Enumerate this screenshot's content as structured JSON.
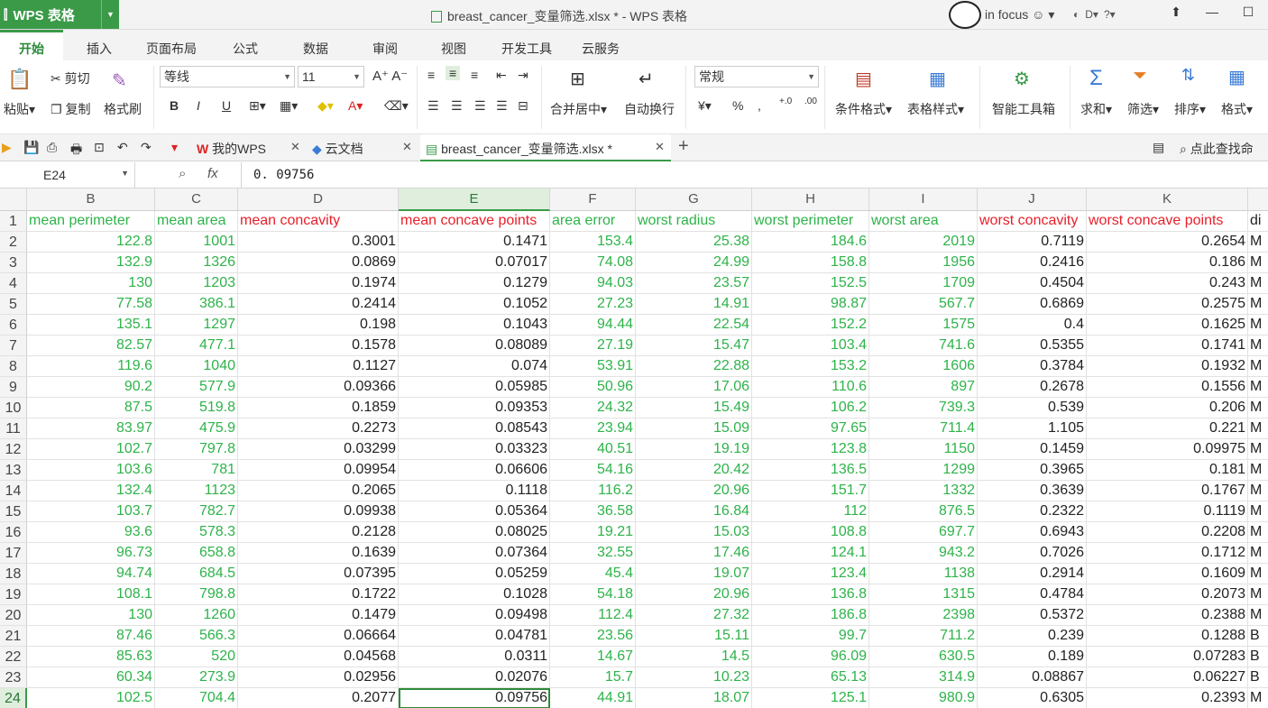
{
  "titlebar": {
    "app_name": "WPS 表格",
    "window_title": "breast_cancer_变量筛选.xlsx * - WPS 表格",
    "user": "in focus"
  },
  "menu": {
    "tabs": [
      "开始",
      "插入",
      "页面布局",
      "公式",
      "数据",
      "审阅",
      "视图",
      "开发工具",
      "云服务"
    ]
  },
  "ribbon": {
    "paste": "粘贴",
    "cut": "剪切",
    "copy": "复制",
    "format_painter": "格式刷",
    "font_name": "等线",
    "font_size": "11",
    "merge_center": "合并居中",
    "wrap_text": "自动换行",
    "number_format": "常规",
    "cond_format": "条件格式",
    "table_style": "表格样式",
    "smart_tools": "智能工具箱",
    "sum": "求和",
    "filter": "筛选",
    "sort": "排序",
    "format": "格式"
  },
  "doctabs": {
    "mywps": "我的WPS",
    "cloud": "云文档",
    "file": "breast_cancer_变量筛选.xlsx *",
    "search": "点此查找命"
  },
  "formula": {
    "cell_ref": "E24",
    "value": "0. 09756"
  },
  "colors": {
    "green_text": "#2eb34a",
    "red_text": "#e8202a",
    "accent": "#3a9a48"
  },
  "sheet": {
    "col_letters": [
      "B",
      "C",
      "D",
      "E",
      "F",
      "G",
      "H",
      "I",
      "J",
      "K",
      ""
    ],
    "headers": [
      "mean perimeter",
      "mean area",
      "mean concavity",
      "mean concave points",
      "area error",
      "worst radius",
      "worst perimeter",
      "worst area",
      "worst concavity",
      "worst concave points",
      "di"
    ],
    "header_colors": [
      "g",
      "g",
      "r",
      "r",
      "g",
      "g",
      "g",
      "g",
      "r",
      "r",
      "k"
    ],
    "value_colors": [
      "g",
      "g",
      "k",
      "k",
      "g",
      "g",
      "g",
      "g",
      "k",
      "k",
      "k"
    ],
    "row_numbers": [
      "1",
      "2",
      "3",
      "4",
      "5",
      "6",
      "7",
      "8",
      "9",
      "10",
      "11",
      "12",
      "13",
      "14",
      "15",
      "16",
      "17",
      "18",
      "19",
      "20",
      "21",
      "22",
      "23",
      "24"
    ],
    "rows": [
      [
        "122.8",
        "1001",
        "0.3001",
        "0.1471",
        "153.4",
        "25.38",
        "184.6",
        "2019",
        "0.7119",
        "0.2654",
        "M"
      ],
      [
        "132.9",
        "1326",
        "0.0869",
        "0.07017",
        "74.08",
        "24.99",
        "158.8",
        "1956",
        "0.2416",
        "0.186",
        "M"
      ],
      [
        "130",
        "1203",
        "0.1974",
        "0.1279",
        "94.03",
        "23.57",
        "152.5",
        "1709",
        "0.4504",
        "0.243",
        "M"
      ],
      [
        "77.58",
        "386.1",
        "0.2414",
        "0.1052",
        "27.23",
        "14.91",
        "98.87",
        "567.7",
        "0.6869",
        "0.2575",
        "M"
      ],
      [
        "135.1",
        "1297",
        "0.198",
        "0.1043",
        "94.44",
        "22.54",
        "152.2",
        "1575",
        "0.4",
        "0.1625",
        "M"
      ],
      [
        "82.57",
        "477.1",
        "0.1578",
        "0.08089",
        "27.19",
        "15.47",
        "103.4",
        "741.6",
        "0.5355",
        "0.1741",
        "M"
      ],
      [
        "119.6",
        "1040",
        "0.1127",
        "0.074",
        "53.91",
        "22.88",
        "153.2",
        "1606",
        "0.3784",
        "0.1932",
        "M"
      ],
      [
        "90.2",
        "577.9",
        "0.09366",
        "0.05985",
        "50.96",
        "17.06",
        "110.6",
        "897",
        "0.2678",
        "0.1556",
        "M"
      ],
      [
        "87.5",
        "519.8",
        "0.1859",
        "0.09353",
        "24.32",
        "15.49",
        "106.2",
        "739.3",
        "0.539",
        "0.206",
        "M"
      ],
      [
        "83.97",
        "475.9",
        "0.2273",
        "0.08543",
        "23.94",
        "15.09",
        "97.65",
        "711.4",
        "1.105",
        "0.221",
        "M"
      ],
      [
        "102.7",
        "797.8",
        "0.03299",
        "0.03323",
        "40.51",
        "19.19",
        "123.8",
        "1150",
        "0.1459",
        "0.09975",
        "M"
      ],
      [
        "103.6",
        "781",
        "0.09954",
        "0.06606",
        "54.16",
        "20.42",
        "136.5",
        "1299",
        "0.3965",
        "0.181",
        "M"
      ],
      [
        "132.4",
        "1123",
        "0.2065",
        "0.1118",
        "116.2",
        "20.96",
        "151.7",
        "1332",
        "0.3639",
        "0.1767",
        "M"
      ],
      [
        "103.7",
        "782.7",
        "0.09938",
        "0.05364",
        "36.58",
        "16.84",
        "112",
        "876.5",
        "0.2322",
        "0.1119",
        "M"
      ],
      [
        "93.6",
        "578.3",
        "0.2128",
        "0.08025",
        "19.21",
        "15.03",
        "108.8",
        "697.7",
        "0.6943",
        "0.2208",
        "M"
      ],
      [
        "96.73",
        "658.8",
        "0.1639",
        "0.07364",
        "32.55",
        "17.46",
        "124.1",
        "943.2",
        "0.7026",
        "0.1712",
        "M"
      ],
      [
        "94.74",
        "684.5",
        "0.07395",
        "0.05259",
        "45.4",
        "19.07",
        "123.4",
        "1138",
        "0.2914",
        "0.1609",
        "M"
      ],
      [
        "108.1",
        "798.8",
        "0.1722",
        "0.1028",
        "54.18",
        "20.96",
        "136.8",
        "1315",
        "0.4784",
        "0.2073",
        "M"
      ],
      [
        "130",
        "1260",
        "0.1479",
        "0.09498",
        "112.4",
        "27.32",
        "186.8",
        "2398",
        "0.5372",
        "0.2388",
        "M"
      ],
      [
        "87.46",
        "566.3",
        "0.06664",
        "0.04781",
        "23.56",
        "15.11",
        "99.7",
        "711.2",
        "0.239",
        "0.1288",
        "B"
      ],
      [
        "85.63",
        "520",
        "0.04568",
        "0.0311",
        "14.67",
        "14.5",
        "96.09",
        "630.5",
        "0.189",
        "0.07283",
        "B"
      ],
      [
        "60.34",
        "273.9",
        "0.02956",
        "0.02076",
        "15.7",
        "10.23",
        "65.13",
        "314.9",
        "0.08867",
        "0.06227",
        "B"
      ],
      [
        "102.5",
        "704.4",
        "0.2077",
        "0.09756",
        "44.91",
        "18.07",
        "125.1",
        "980.9",
        "0.6305",
        "0.2393",
        "M"
      ]
    ]
  }
}
